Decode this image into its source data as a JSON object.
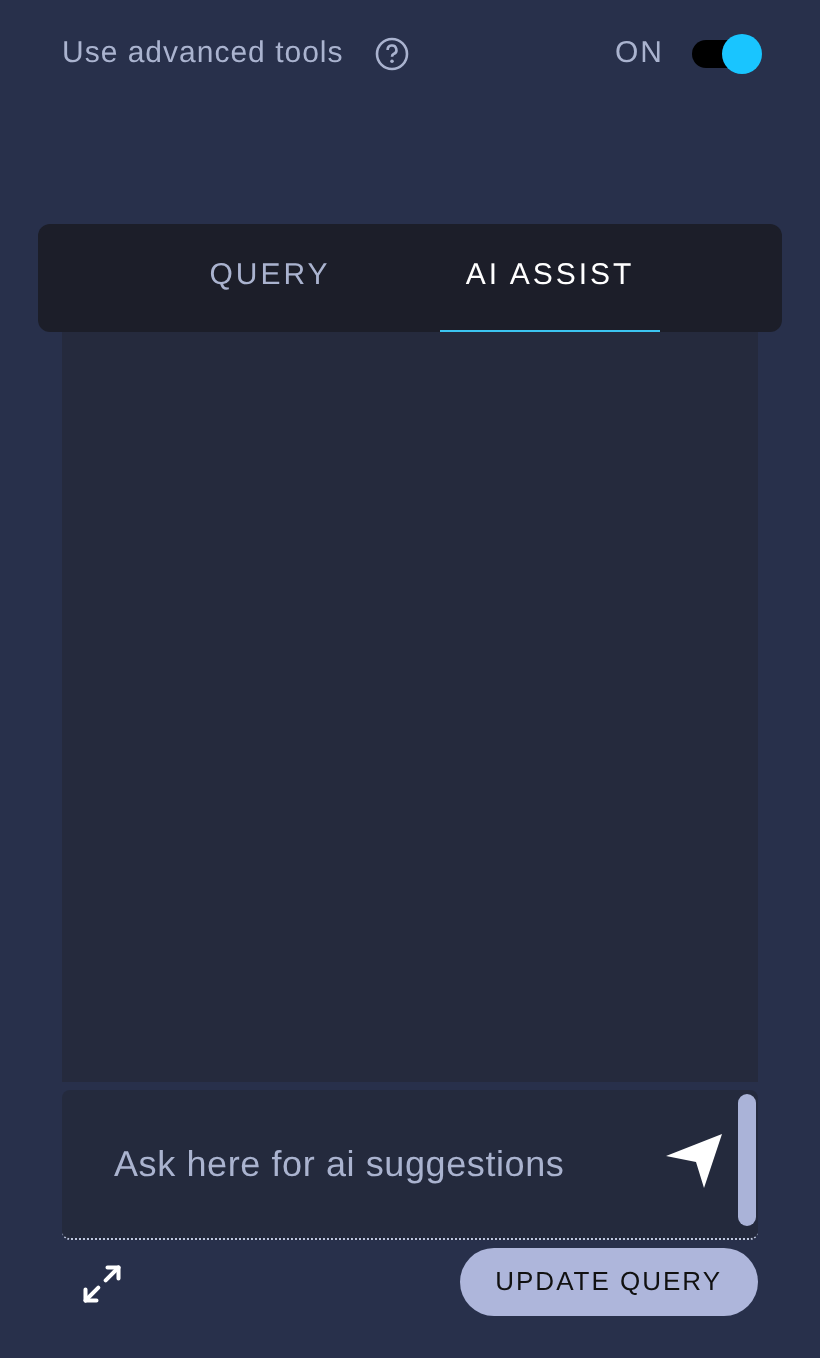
{
  "advanced_tools": {
    "label": "Use advanced tools",
    "status": "ON",
    "on": true
  },
  "tabs": [
    {
      "label": "QUERY",
      "selected": false
    },
    {
      "label": "AI ASSIST",
      "selected": true
    }
  ],
  "prompt": {
    "placeholder": "Ask here for ai suggestions"
  },
  "update_button": "UPDATE QUERY"
}
